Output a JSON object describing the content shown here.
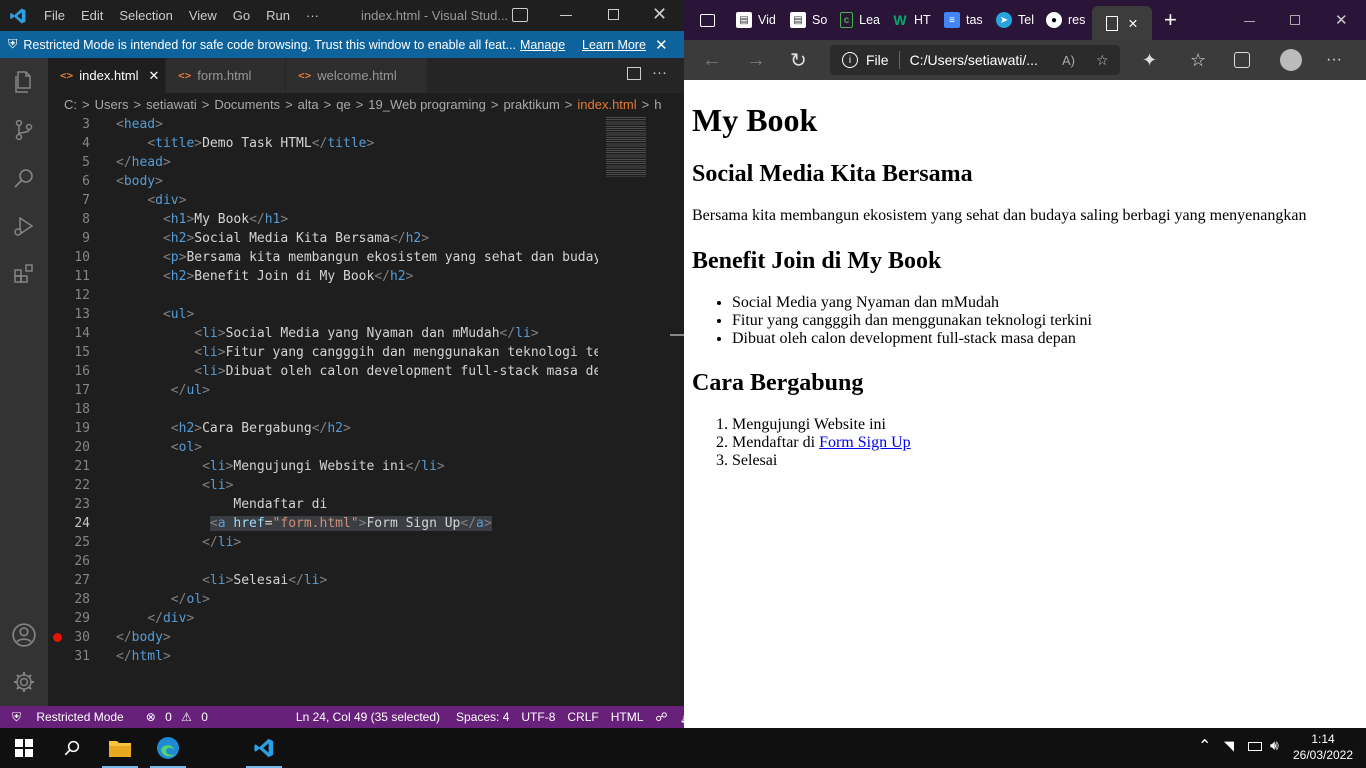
{
  "vscode": {
    "title": "index.html - Visual Stud...",
    "menu": [
      "File",
      "Edit",
      "Selection",
      "View",
      "Go",
      "Run",
      "···"
    ],
    "banner_text": "Restricted Mode is intended for safe code browsing. Trust this window to enable all feat...",
    "banner_manage": "Manage",
    "banner_learn": "Learn More",
    "tabs": [
      {
        "label": "index.html",
        "active": true
      },
      {
        "label": "form.html",
        "active": false
      },
      {
        "label": "welcome.html",
        "active": false
      }
    ],
    "breadcrumb": [
      "C:",
      ">",
      "Users",
      ">",
      "setiawati",
      ">",
      "Documents",
      ">",
      "alta",
      ">",
      "qe",
      ">",
      "19_Web programing",
      ">",
      "praktikum",
      ">",
      "index.html",
      ">",
      "h"
    ],
    "line_numbers": [
      "3",
      "4",
      "5",
      "6",
      "7",
      "8",
      "9",
      "10",
      "11",
      "12",
      "13",
      "14",
      "15",
      "16",
      "17",
      "18",
      "19",
      "20",
      "21",
      "22",
      "23",
      "24",
      "25",
      "26",
      "27",
      "28",
      "29",
      "30",
      "31"
    ],
    "status": {
      "restricted": "Restricted Mode",
      "errors": "0",
      "warnings": "0",
      "position": "Ln 24, Col 49 (35 selected)",
      "spaces": "Spaces: 4",
      "encoding": "UTF-8",
      "eol": "CRLF",
      "language": "HTML"
    }
  },
  "browser": {
    "tabs": [
      "Vid",
      "So",
      "Lea",
      "HT",
      "tas",
      "Tel",
      "res"
    ],
    "address": "C:/Users/setiawati/...",
    "address_label": "File",
    "page": {
      "h1": "My Book",
      "h2_social": "Social Media Kita Bersama",
      "paragraph": "Bersama kita membangun ekosistem yang sehat dan budaya saling berbagi yang menyenangkan",
      "h2_benefit": "Benefit Join di My Book",
      "benefits": [
        "Social Media yang Nyaman dan mMudah",
        "Fitur yang cangggih dan menggunakan teknologi terkini",
        "Dibuat oleh calon development full-stack masa depan"
      ],
      "h2_join": "Cara Bergabung",
      "step1": "Mengujungi Website ini",
      "step2_prefix": "Mendaftar di ",
      "step2_link": "Form Sign Up",
      "step3": "Selesai"
    }
  },
  "taskbar": {
    "time": "1:14",
    "date": "26/03/2022"
  }
}
